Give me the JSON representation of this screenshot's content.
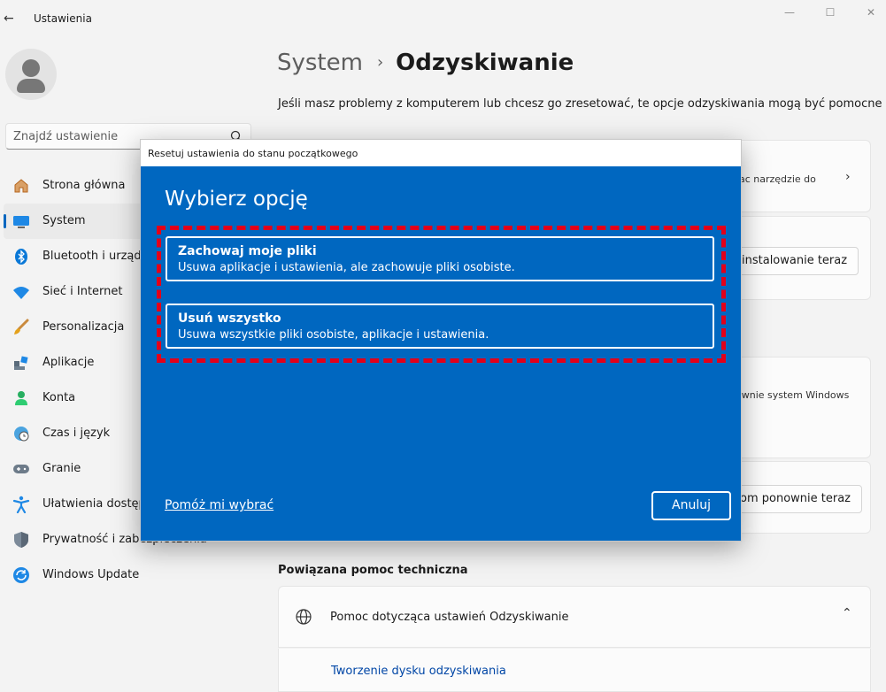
{
  "window": {
    "title": "Ustawienia",
    "back_glyph": "←",
    "minimize_glyph": "—",
    "maximize_glyph": "☐",
    "close_glyph": "✕"
  },
  "search": {
    "placeholder": "Znajdź ustawienie"
  },
  "sidebar": {
    "items": [
      {
        "label": "Strona główna",
        "icon": "home-icon"
      },
      {
        "label": "System",
        "icon": "monitor-icon",
        "active": true
      },
      {
        "label": "Bluetooth i urządzenia",
        "icon": "bluetooth-icon"
      },
      {
        "label": "Sieć i Internet",
        "icon": "wifi-icon"
      },
      {
        "label": "Personalizacja",
        "icon": "brush-icon"
      },
      {
        "label": "Aplikacje",
        "icon": "apps-icon"
      },
      {
        "label": "Konta",
        "icon": "person-icon"
      },
      {
        "label": "Czas i język",
        "icon": "clock-globe-icon"
      },
      {
        "label": "Granie",
        "icon": "gamepad-icon"
      },
      {
        "label": "Ułatwienia dostępu",
        "icon": "accessibility-icon"
      },
      {
        "label": "Prywatność i zabezpieczenia",
        "icon": "shield-icon"
      },
      {
        "label": "Windows Update",
        "icon": "update-icon"
      }
    ]
  },
  "header": {
    "parent": "System",
    "separator": "›",
    "current": "Odzyskiwanie",
    "description": "Jeśli masz problemy z komputerem lub chcesz go zresetować, te opcje odzyskiwania mogą być pomocne"
  },
  "background_cards": {
    "card1_text": "ac narzędzie do",
    "card2_button": "instalowanie teraz",
    "card3_text": "ownie system Windows",
    "card4_button": "om ponownie teraz"
  },
  "related": {
    "title": "Powiązana pomoc techniczna",
    "help_item": "Pomoc dotycząca ustawień Odzyskiwanie",
    "link": "Tworzenie dysku odzyskiwania"
  },
  "dialog": {
    "window_title": "Resetuj ustawienia do stanu początkowego",
    "heading": "Wybierz opcję",
    "options": [
      {
        "title": "Zachowaj moje pliki",
        "description": "Usuwa aplikacje i ustawienia, ale zachowuje pliki osobiste."
      },
      {
        "title": "Usuń wszystko",
        "description": "Usuwa wszystkie pliki osobiste, aplikacje i ustawienia."
      }
    ],
    "help_link": "Pomóż mi wybrać",
    "cancel": "Anuluj"
  },
  "colors": {
    "accent": "#0067c0",
    "highlight": "#e2001a",
    "link": "#0046a6"
  }
}
